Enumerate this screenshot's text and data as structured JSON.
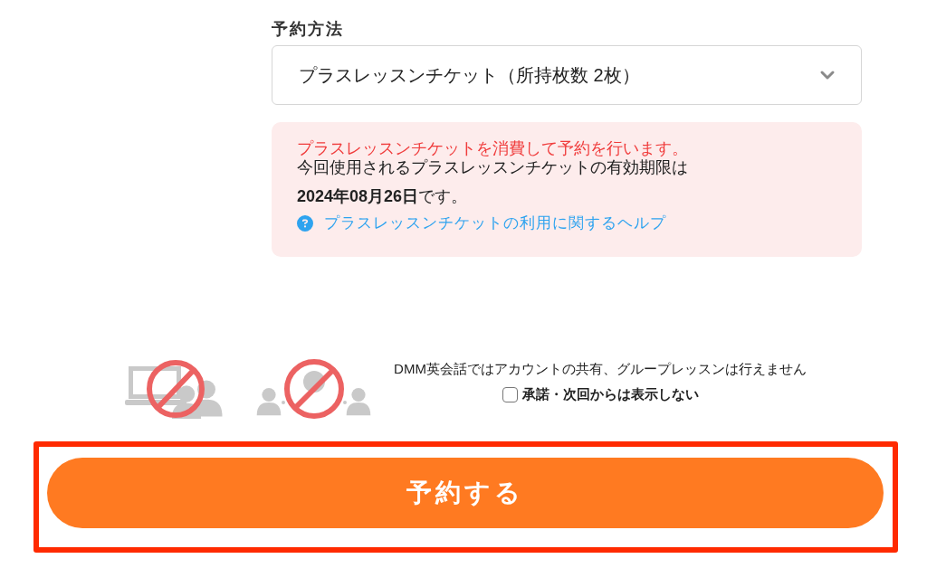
{
  "reservation_method": {
    "label": "予約方法",
    "select": {
      "value": "プラスレッスンチケット（所持枚数 2枚）"
    }
  },
  "notice": {
    "warning": "プラスレッスンチケットを消費して予約を行います。",
    "message_lines": [
      "今回使用されるプラスレッスンチケットの有効期限は",
      "**2024年08月26日**です。"
    ],
    "help_link": "プラスレッスンチケットの利用に関するヘルプ"
  },
  "policy": {
    "text": "DMM英会話ではアカウントの共有、グループレッスンは行えません",
    "checkbox": {
      "label": "承諾・次回からは表示しない",
      "checked": false
    }
  },
  "reserve_button": {
    "label": "予約する",
    "highlighted": true
  }
}
